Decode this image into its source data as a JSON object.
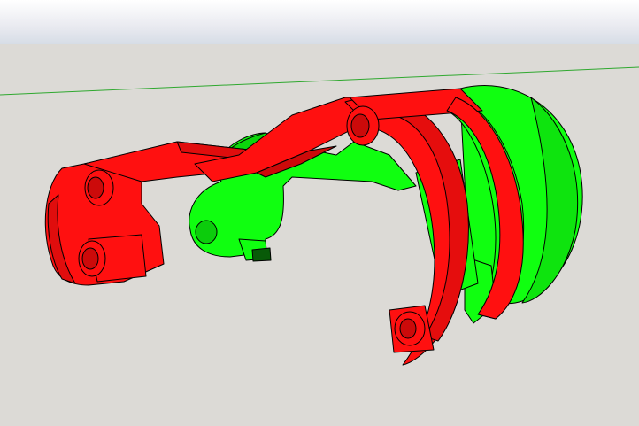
{
  "app": {
    "name": "",
    "view": "3d-model-viewport"
  },
  "scene": {
    "colors": {
      "sky_top": "#ffffff",
      "sky_bottom": "#d6dde6",
      "ground": "#dcdad6",
      "green_axis": "#2fa82f",
      "part_red": "#ff1010",
      "part_green": "#10ff10",
      "edge": "#000000"
    },
    "objects": [
      {
        "name": "red-part",
        "color": "#ff1010"
      },
      {
        "name": "green-part",
        "color": "#10ff10"
      }
    ]
  }
}
